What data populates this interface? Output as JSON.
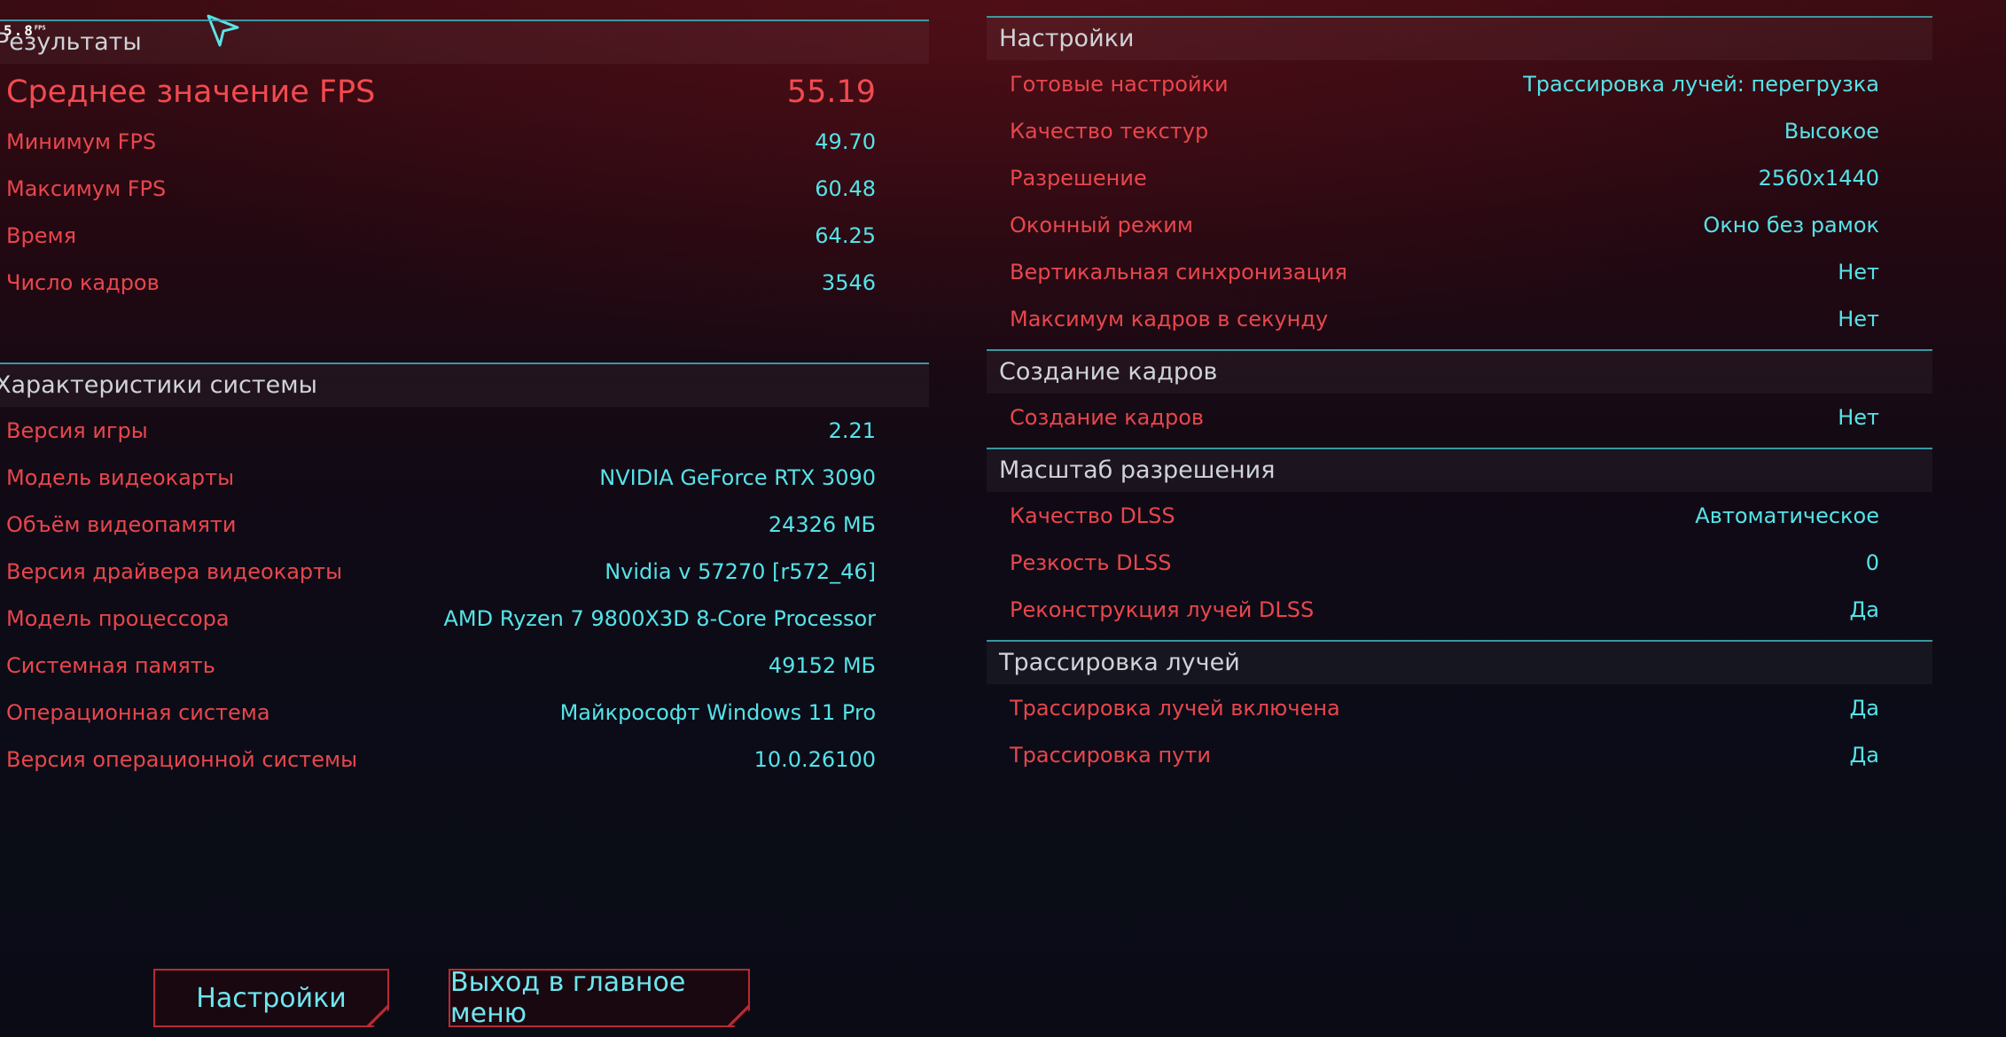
{
  "overlay": {
    "fps_text": "5.8",
    "fps_unit": "FPS"
  },
  "results": {
    "title": "Результаты",
    "average": {
      "label": "Среднее значение FPS",
      "value": "55.19"
    },
    "rows": [
      {
        "label": "Минимум FPS",
        "value": "49.70"
      },
      {
        "label": "Максимум FPS",
        "value": "60.48"
      },
      {
        "label": "Время",
        "value": "64.25"
      },
      {
        "label": "Число кадров",
        "value": "3546"
      }
    ]
  },
  "system": {
    "title": "Характеристики системы",
    "rows": [
      {
        "label": "Версия игры",
        "value": "2.21"
      },
      {
        "label": "Модель видеокарты",
        "value": "NVIDIA GeForce RTX 3090"
      },
      {
        "label": "Объём видеопамяти",
        "value": "24326 МБ"
      },
      {
        "label": "Версия драйвера видеокарты",
        "value": "Nvidia v 57270 [r572_46]"
      },
      {
        "label": "Модель процессора",
        "value": "AMD Ryzen 7 9800X3D 8-Core Processor"
      },
      {
        "label": "Системная память",
        "value": "49152 МБ"
      },
      {
        "label": "Операционная система",
        "value": "Майкрософт Windows 11 Pro"
      },
      {
        "label": "Версия операционной системы",
        "value": "10.0.26100"
      }
    ]
  },
  "settings": {
    "title": "Настройки",
    "rows": [
      {
        "label": "Готовые настройки",
        "value": "Трассировка лучей: перегрузка"
      },
      {
        "label": "Качество текстур",
        "value": "Высокое"
      },
      {
        "label": "Разрешение",
        "value": "2560x1440"
      },
      {
        "label": "Оконный режим",
        "value": "Окно без рамок"
      },
      {
        "label": "Вертикальная синхронизация",
        "value": "Нет"
      },
      {
        "label": "Максимум кадров в секунду",
        "value": "Нет"
      }
    ]
  },
  "frame_gen": {
    "title": "Создание кадров",
    "rows": [
      {
        "label": "Создание кадров",
        "value": "Нет"
      }
    ]
  },
  "resolution_scaling": {
    "title": "Масштаб разрешения",
    "rows": [
      {
        "label": "Качество DLSS",
        "value": "Автоматическое"
      },
      {
        "label": "Резкость DLSS",
        "value": "0"
      },
      {
        "label": "Реконструкция лучей DLSS",
        "value": "Да"
      }
    ]
  },
  "ray_tracing": {
    "title": "Трассировка лучей",
    "rows": [
      {
        "label": "Трассировка лучей включена",
        "value": "Да"
      },
      {
        "label": "Трассировка пути",
        "value": "Да"
      }
    ]
  },
  "buttons": {
    "settings_label": "Настройки",
    "exit_label": "Выход в главное меню"
  },
  "colors": {
    "label_red": "#e8464c",
    "value_cyan": "#55e3e8",
    "divider": "#3fb0b8",
    "button_border": "#b82a33"
  }
}
